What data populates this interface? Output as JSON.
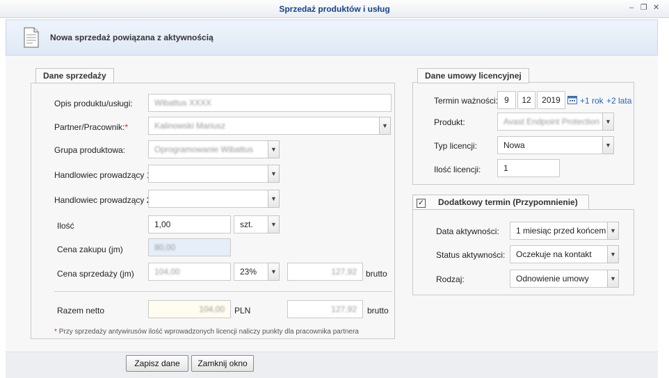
{
  "window": {
    "title": "Sprzedaż produktów i usług",
    "header_text": "Nowa sprzedaż powiązana z aktywnością",
    "minimize_glyph": "–",
    "restore_glyph": "❐",
    "close_glyph": "✕"
  },
  "sales_panel": {
    "legend": "Dane sprzedaży",
    "product_description_label": "Opis produktu/usługi:",
    "product_description_value": "Wibattus XXXX",
    "partner_label": "Partner/Pracownik:",
    "required_marker": "*",
    "partner_value": "Kalinowski Mariusz",
    "product_group_label": "Grupa produktowa:",
    "product_group_value": "Oprogramowanie Wibattus",
    "sales_rep1_label": "Handlowiec prowadzący 1:",
    "sales_rep1_value": "",
    "sales_rep2_label": "Handlowiec prowadzący 2:",
    "sales_rep2_value": "",
    "quantity_label": "Ilość",
    "quantity_value": "1,00",
    "unit_value": "szt.",
    "purchase_price_label": "Cena zakupu (jm)",
    "purchase_price_value": "80,00",
    "sale_price_label": "Cena sprzedaży (jm)",
    "sale_price_value": "104,00",
    "vat_value": "23%",
    "gross_unit_value": "127,92",
    "gross_label": "brutto",
    "total_net_label": "Razem netto",
    "total_net_value": "104,00",
    "currency_label": "PLN",
    "total_gross_value": "127,92",
    "footnote_marker": "*",
    "footnote": "Przy sprzedaży antywirusów ilość wprowadzonych licencji naliczy punkty dla pracownika partnera"
  },
  "license_panel": {
    "legend": "Dane umowy licencyjnej",
    "validity_label": "Termin ważności:",
    "day": "9",
    "month": "12",
    "year": "2019",
    "plus_one_year": "+1 rok",
    "plus_two_years": "+2 lata",
    "product_label": "Produkt:",
    "product_value": "Avast Endpoint Protection",
    "license_type_label": "Typ licencji:",
    "license_type_value": "Nowa",
    "license_count_label": "Ilość licencji:",
    "license_count_value": "1"
  },
  "reminder_panel": {
    "legend": "Dodatkowy termin (Przypomnienie)",
    "checked": true,
    "check_glyph": "✓",
    "activity_date_label": "Data aktywności:",
    "activity_date_value": "1 miesiąc przed końcem",
    "activity_status_label": "Status aktywności:",
    "activity_status_value": "Oczekuje na kontakt",
    "type_label": "Rodzaj:",
    "type_value": "Odnowienie umowy"
  },
  "buttons": {
    "save": "Zapisz dane",
    "close": "Zamknij okno"
  },
  "icons": {
    "arrow_glyph": "▼"
  }
}
